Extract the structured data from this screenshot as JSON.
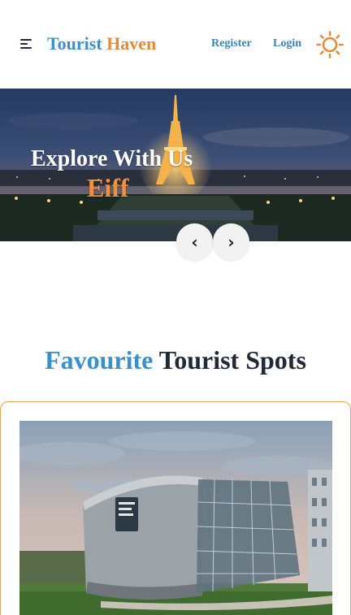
{
  "header": {
    "brand_part1": "Tourist",
    "brand_part2": "Haven",
    "nav": {
      "register": "Register",
      "login": "Login"
    },
    "icons": {
      "menu": "menu-icon",
      "theme": "sun-icon"
    }
  },
  "hero": {
    "title": "Explore With Us",
    "subtitle": "Eiff",
    "prev_symbol": "‹",
    "next_symbol": "›"
  },
  "section": {
    "title_part1": "Favourite",
    "title_part2": "Tourist Spots"
  },
  "colors": {
    "brand_blue": "#3b8fcd",
    "brand_orange": "#e8893a",
    "card_border": "#e8a35c"
  }
}
